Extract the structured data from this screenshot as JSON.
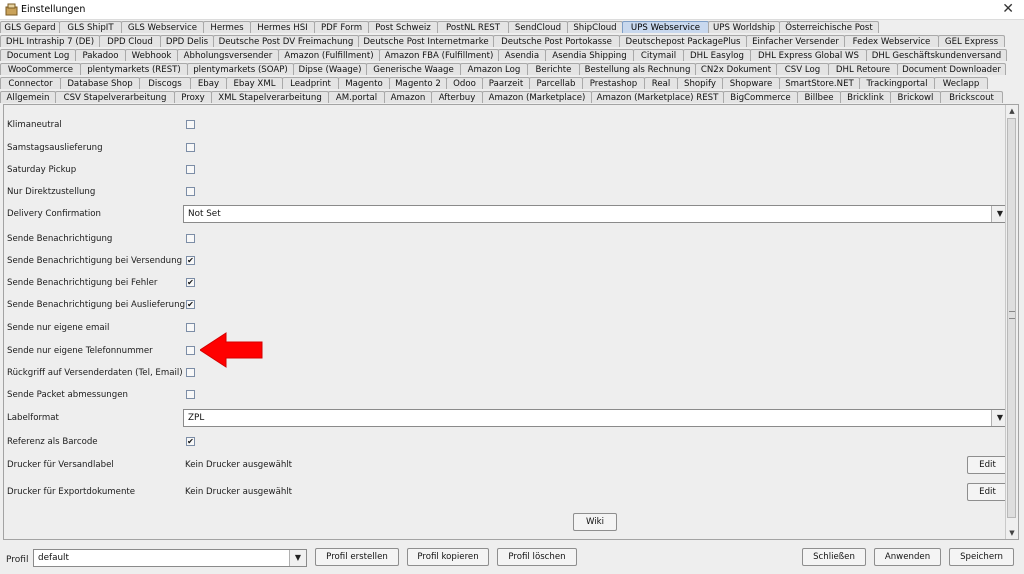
{
  "window": {
    "title": "Einstellungen",
    "close": "✕"
  },
  "tabs": {
    "rows": [
      [
        {
          "label": "GLS Gepard",
          "w": 60
        },
        {
          "label": "GLS ShipIT",
          "w": 63
        },
        {
          "label": "GLS Webservice",
          "w": 83
        },
        {
          "label": "Hermes",
          "w": 48
        },
        {
          "label": "Hermes HSI",
          "w": 65
        },
        {
          "label": "PDF Form",
          "w": 55
        },
        {
          "label": "Post Schweiz",
          "w": 70
        },
        {
          "label": "PostNL REST",
          "w": 72
        },
        {
          "label": "SendCloud",
          "w": 60
        },
        {
          "label": "ShipCloud",
          "w": 56
        },
        {
          "label": "UPS Webservice",
          "w": 87,
          "active": true
        },
        {
          "label": "UPS Worldship",
          "w": 72
        },
        {
          "label": "Österreichische Post",
          "w": 100
        }
      ],
      [
        {
          "label": "DHL Intraship 7 (DE)",
          "w": 100
        },
        {
          "label": "DPD Cloud",
          "w": 62
        },
        {
          "label": "DPD Delis",
          "w": 54
        },
        {
          "label": "Deutsche Post DV Freimachung",
          "w": 146
        },
        {
          "label": "Deutsche Post Internetmarke",
          "w": 136
        },
        {
          "label": "Deutsche Post Portokasse",
          "w": 127
        },
        {
          "label": "Deutschepost PackagePlus",
          "w": 128
        },
        {
          "label": "Einfacher Versender",
          "w": 99
        },
        {
          "label": "Fedex Webservice",
          "w": 95
        },
        {
          "label": "GEL Express",
          "w": 67
        }
      ],
      [
        {
          "label": "Document Log",
          "w": 76
        },
        {
          "label": "Pakadoo",
          "w": 51
        },
        {
          "label": "Webhook",
          "w": 53
        },
        {
          "label": "Abholungsversender",
          "w": 102
        },
        {
          "label": "Amazon (Fulfillment)",
          "w": 102
        },
        {
          "label": "Amazon FBA (Fulfillment)",
          "w": 120
        },
        {
          "label": "Asendia",
          "w": 48
        },
        {
          "label": "Asendia Shipping",
          "w": 89
        },
        {
          "label": "Citymail",
          "w": 51
        },
        {
          "label": "DHL Easylog",
          "w": 68
        },
        {
          "label": "DHL Express Global WS",
          "w": 117
        },
        {
          "label": "DHL Geschäftskundenversand",
          "w": 141
        }
      ],
      [
        {
          "label": "WooCommerce",
          "w": 81
        },
        {
          "label": "plentymarkets (REST)",
          "w": 108
        },
        {
          "label": "plentymarkets (SOAP)",
          "w": 107
        },
        {
          "label": "Dipse (Waage)",
          "w": 74
        },
        {
          "label": "Generische Waage",
          "w": 95
        },
        {
          "label": "Amazon Log",
          "w": 68
        },
        {
          "label": "Berichte",
          "w": 53
        },
        {
          "label": "Bestellung als Rechnung",
          "w": 117
        },
        {
          "label": "CN2x Dokument",
          "w": 82
        },
        {
          "label": "CSV Log",
          "w": 53
        },
        {
          "label": "DHL Retoure",
          "w": 70
        },
        {
          "label": "Document Downloader",
          "w": 109
        }
      ],
      [
        {
          "label": "Connector",
          "w": 61
        },
        {
          "label": "Database Shop",
          "w": 80
        },
        {
          "label": "Discogs",
          "w": 52
        },
        {
          "label": "Ebay",
          "w": 37
        },
        {
          "label": "Ebay XML",
          "w": 57
        },
        {
          "label": "Leadprint",
          "w": 57
        },
        {
          "label": "Magento",
          "w": 52
        },
        {
          "label": "Magento 2",
          "w": 58
        },
        {
          "label": "Odoo",
          "w": 37
        },
        {
          "label": "Paarzeit",
          "w": 48
        },
        {
          "label": "Parcellab",
          "w": 54
        },
        {
          "label": "Prestashop",
          "w": 63
        },
        {
          "label": "Real",
          "w": 34
        },
        {
          "label": "Shopify",
          "w": 46
        },
        {
          "label": "Shopware",
          "w": 58
        },
        {
          "label": "SmartStore.NET",
          "w": 81
        },
        {
          "label": "Trackingportal",
          "w": 76
        },
        {
          "label": "Weclapp",
          "w": 54
        }
      ],
      [
        {
          "label": "Allgemein",
          "w": 56
        },
        {
          "label": "CSV Stapelverarbeitung",
          "w": 120
        },
        {
          "label": "Proxy",
          "w": 38
        },
        {
          "label": "XML Stapelverarbeitung",
          "w": 118
        },
        {
          "label": "AM.portal",
          "w": 57
        },
        {
          "label": "Amazon",
          "w": 48
        },
        {
          "label": "Afterbuy",
          "w": 52
        },
        {
          "label": "Amazon (Marketplace)",
          "w": 110
        },
        {
          "label": "Amazon (Marketplace) REST",
          "w": 133
        },
        {
          "label": "BigCommerce",
          "w": 75
        },
        {
          "label": "Billbee",
          "w": 44
        },
        {
          "label": "Bricklink",
          "w": 51
        },
        {
          "label": "Brickowl",
          "w": 51
        },
        {
          "label": "Brickscout",
          "w": 63
        }
      ]
    ]
  },
  "settings": {
    "rows": [
      {
        "type": "checkbox",
        "label": "Klimaneutral",
        "checked": false
      },
      {
        "type": "checkbox",
        "label": "Samstagsauslieferung",
        "checked": false
      },
      {
        "type": "checkbox",
        "label": "Saturday Pickup",
        "checked": false
      },
      {
        "type": "checkbox",
        "label": "Nur Direktzustellung",
        "checked": false
      },
      {
        "type": "select",
        "label": "Delivery Confirmation",
        "value": "Not Set"
      },
      {
        "type": "checkbox",
        "label": "Sende Benachrichtigung",
        "checked": false
      },
      {
        "type": "checkbox",
        "label": "Sende Benachrichtigung bei Versendung",
        "checked": true
      },
      {
        "type": "checkbox",
        "label": "Sende Benachrichtigung bei Fehler",
        "checked": true
      },
      {
        "type": "checkbox",
        "label": "Sende Benachrichtigung bei Auslieferung",
        "checked": true
      },
      {
        "type": "checkbox",
        "label": "Sende nur eigene email",
        "checked": false
      },
      {
        "type": "checkbox",
        "label": "Sende nur eigene Telefonnummer",
        "checked": false
      },
      {
        "type": "checkbox",
        "label": "Rückgriff auf Versenderdaten (Tel, Email)",
        "checked": false
      },
      {
        "type": "checkbox",
        "label": "Sende Packet abmessungen",
        "checked": false
      },
      {
        "type": "select",
        "label": "Labelformat",
        "value": "ZPL"
      },
      {
        "type": "checkbox",
        "label": "Referenz als Barcode",
        "checked": true
      },
      {
        "type": "printer",
        "label": "Drucker für Versandlabel",
        "value": "Kein Drucker ausgewählt",
        "button": "Edit"
      },
      {
        "type": "printer",
        "label": "Drucker für Exportdokumente",
        "value": "Kein Drucker ausgewählt",
        "button": "Edit"
      }
    ],
    "wiki_button": "Wiki",
    "highlight_color": "#ff0000"
  },
  "bottom": {
    "profile_label": "Profil",
    "profile_value": "default",
    "create": "Profil erstellen",
    "copy": "Profil kopieren",
    "delete": "Profil löschen",
    "close": "Schließen",
    "apply": "Anwenden",
    "save": "Speichern"
  }
}
